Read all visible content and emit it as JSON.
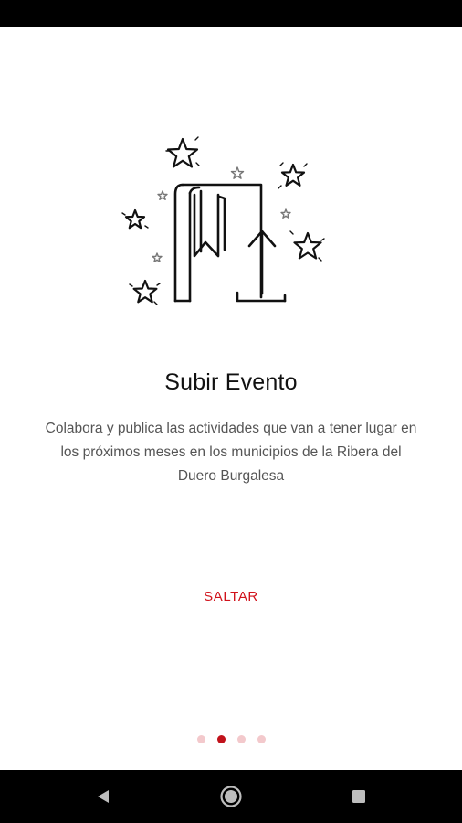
{
  "onboarding": {
    "title": "Subir Evento",
    "description": "Colabora y publica las actividades que van a tener lugar en los próximos meses en los municipios de la Ribera del Duero Burgalesa",
    "skip_label": "SALTAR",
    "illustration_icon": "book-upload-with-stars-icon",
    "page_indicator": {
      "total": 4,
      "current": 2
    }
  },
  "colors": {
    "accent": "#d1121b",
    "indicator_active": "#c1121b",
    "indicator_inactive": "#f3c9cc",
    "bars": "#000000"
  },
  "system_nav": {
    "back_icon": "back-triangle-icon",
    "home_icon": "home-circle-icon",
    "recents_icon": "recents-square-icon"
  }
}
